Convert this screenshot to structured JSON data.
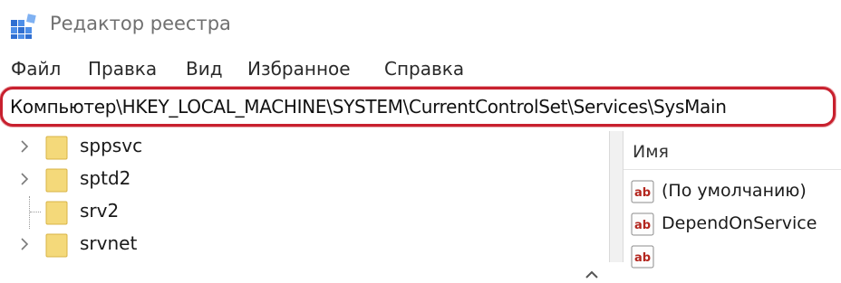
{
  "window": {
    "title": "Редактор реестра",
    "app_icon": "registry-editor-icon"
  },
  "menu": {
    "items": [
      "Файл",
      "Правка",
      "Вид",
      "Избранное",
      "Справка"
    ]
  },
  "address_bar": {
    "path": "Компьютер\\HKEY_LOCAL_MACHINE\\SYSTEM\\CurrentControlSet\\Services\\SysMain",
    "highlight_color": "#c8202e"
  },
  "tree": {
    "items": [
      {
        "label": "sppsvc",
        "expander": "chevron-right-icon"
      },
      {
        "label": "sptd2",
        "expander": "chevron-right-icon"
      },
      {
        "label": "srv2",
        "expander": "none"
      },
      {
        "label": "srvnet",
        "expander": "chevron-right-icon"
      }
    ]
  },
  "values_pane": {
    "column_name": "Имя",
    "items": [
      {
        "label": "(По умолчанию)",
        "icon": "string-value-icon"
      },
      {
        "label": "DependOnService",
        "icon": "string-value-icon"
      },
      {
        "label": "",
        "icon": "string-value-icon"
      }
    ]
  },
  "colors": {
    "folder": "#f4d97a",
    "folder_edge": "#d9b447",
    "ab_text": "#b3261e"
  }
}
